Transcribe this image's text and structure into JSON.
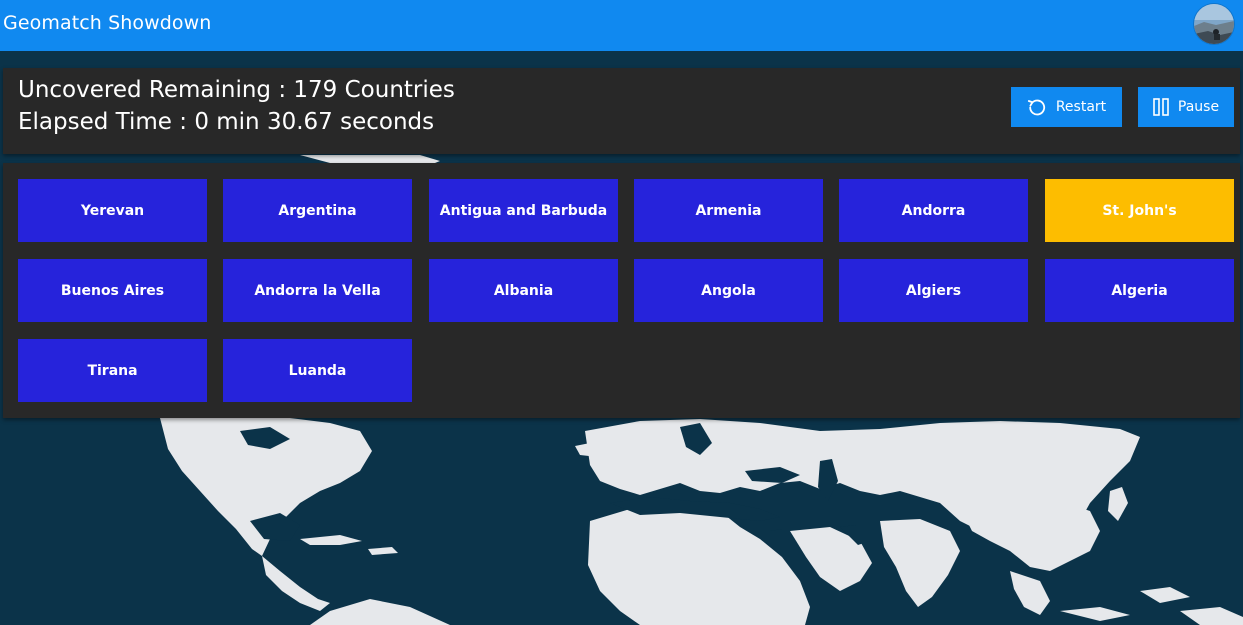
{
  "app": {
    "title": "Geomatch Showdown"
  },
  "status": {
    "remaining": "Uncovered Remaining : 179 Countries",
    "elapsed": "Elapsed Time : 0 min 30.67 seconds"
  },
  "controls": {
    "restart_label": "Restart",
    "restart_icon": "restart-icon",
    "pause_label": "Pause",
    "pause_icon": "pause-icon"
  },
  "cards": [
    {
      "label": "Yerevan",
      "selected": false
    },
    {
      "label": "Argentina",
      "selected": false
    },
    {
      "label": "Antigua and Barbuda",
      "selected": false
    },
    {
      "label": "Armenia",
      "selected": false
    },
    {
      "label": "Andorra",
      "selected": false
    },
    {
      "label": "St. John's",
      "selected": true
    },
    {
      "label": "Buenos Aires",
      "selected": false
    },
    {
      "label": "Andorra la Vella",
      "selected": false
    },
    {
      "label": "Albania",
      "selected": false
    },
    {
      "label": "Angola",
      "selected": false
    },
    {
      "label": "Algiers",
      "selected": false
    },
    {
      "label": "Algeria",
      "selected": false
    },
    {
      "label": "Tirana",
      "selected": false
    },
    {
      "label": "Luanda",
      "selected": false
    }
  ],
  "colors": {
    "topbar": "#1089f0",
    "panel": "#282828",
    "card": "#2623db",
    "card_selected": "#fdbd00",
    "ocean": "#0b3349",
    "land": "#e6e8eb"
  }
}
